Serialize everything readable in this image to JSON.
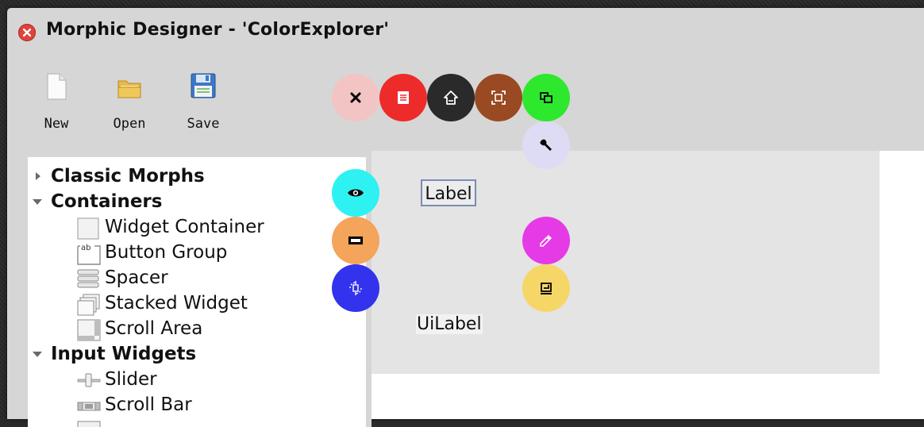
{
  "window": {
    "title": "Morphic Designer - 'ColorExplorer'"
  },
  "toolbar": {
    "new_label": "New",
    "open_label": "Open",
    "save_label": "Save"
  },
  "tree": {
    "categories": [
      {
        "label": "Classic Morphs",
        "expanded": false
      },
      {
        "label": "Containers",
        "expanded": true
      },
      {
        "label": "Input Widgets",
        "expanded": true
      }
    ],
    "container_items": [
      {
        "label": "Widget Container",
        "icon": "widget-container-icon"
      },
      {
        "label": "Button Group",
        "icon": "button-group-icon"
      },
      {
        "label": "Spacer",
        "icon": "spacer-icon"
      },
      {
        "label": "Stacked Widget",
        "icon": "stacked-widget-icon"
      },
      {
        "label": "Scroll Area",
        "icon": "scroll-area-icon"
      }
    ],
    "input_items": [
      {
        "label": "Slider",
        "icon": "slider-icon"
      },
      {
        "label": "Scroll Bar",
        "icon": "scroll-bar-icon"
      }
    ]
  },
  "canvas": {
    "label_widget_text": "Label",
    "uilabel_text": "UiLabel"
  },
  "halo_colors": {
    "delete": "#f2c4c4",
    "menu": "#ee2b2b",
    "raise": "#2a2a2a",
    "grab": "#9a4a22",
    "duplicate": "#2ee82e",
    "debug": "#dedcf4",
    "view": "#2ef2f2",
    "collapse": "#f5a45c",
    "rotate": "#3333ee",
    "color_picker": "#e63ae6",
    "resize": "#f7d668"
  }
}
